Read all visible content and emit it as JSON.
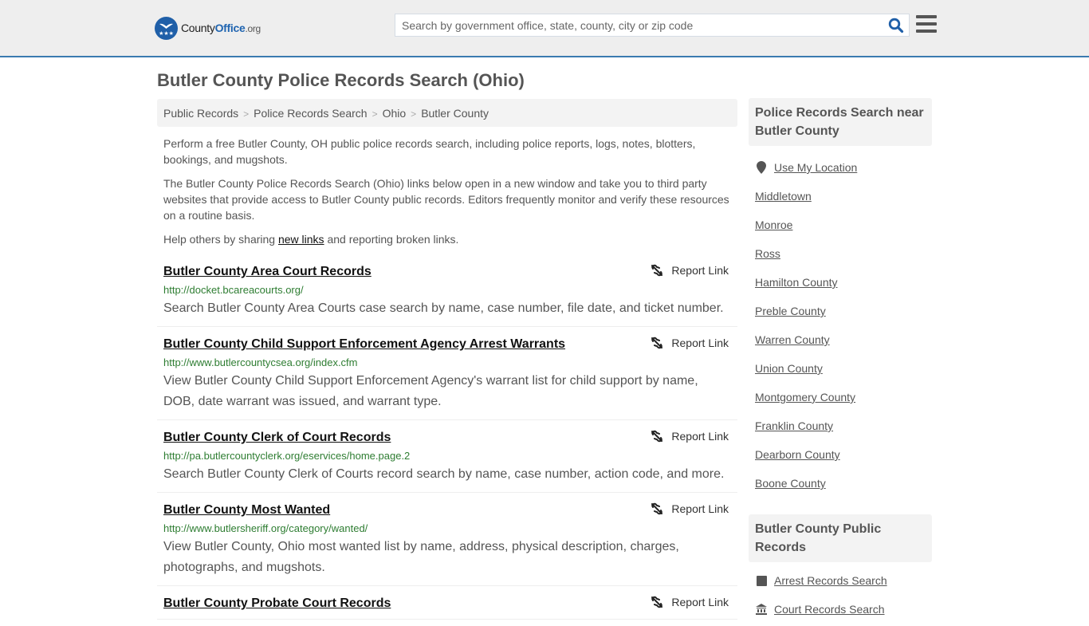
{
  "header": {
    "logo": {
      "name_part1": "County",
      "name_part2": "Office",
      "name_part3": ".org",
      "brand_color": "#1f5fa8"
    },
    "search": {
      "placeholder": "Search by government office, state, county, city or zip code",
      "value": ""
    },
    "search_icon": "search-icon",
    "menu_icon": "hamburger-menu-icon"
  },
  "page": {
    "title": "Butler County Police Records Search (Ohio)",
    "breadcrumb": [
      "Public Records",
      "Police Records Search",
      "Ohio",
      "Butler County"
    ],
    "intro": {
      "p1": "Perform a free Butler County, OH public police records search, including police reports, logs, notes, blotters, bookings, and mugshots.",
      "p2": "The Butler County Police Records Search (Ohio) links below open in a new window and take you to third party websites that provide access to Butler County public records. Editors frequently monitor and verify these resources on a routine basis.",
      "p3_before": "Help others by sharing ",
      "p3_link": "new links",
      "p3_after": " and reporting broken links."
    },
    "report_label": "Report Link",
    "results": [
      {
        "title": "Butler County Area Court Records",
        "url": "http://docket.bcareacourts.org/",
        "description": "Search Butler County Area Courts case search by name, case number, file date, and ticket number."
      },
      {
        "title": "Butler County Child Support Enforcement Agency Arrest Warrants",
        "url": "http://www.butlercountycsea.org/index.cfm",
        "description": "View Butler County Child Support Enforcement Agency's warrant list for child support by name, DOB, date warrant was issued, and warrant type."
      },
      {
        "title": "Butler County Clerk of Court Records",
        "url": "http://pa.butlercountyclerk.org/eservices/home.page.2",
        "description": "Search Butler County Clerk of Courts record search by name, case number, action code, and more."
      },
      {
        "title": "Butler County Most Wanted",
        "url": "http://www.butlersheriff.org/category/wanted/",
        "description": "View Butler County, Ohio most wanted list by name, address, physical description, charges, photographs, and mugshots."
      },
      {
        "title": "Butler County Probate Court Records",
        "url": "",
        "description": ""
      }
    ]
  },
  "sidebar": {
    "nearby": {
      "heading": "Police Records Search near Butler County",
      "use_location": "Use My Location",
      "items": [
        "Middletown",
        "Monroe",
        "Ross",
        "Hamilton County",
        "Preble County",
        "Warren County",
        "Union County",
        "Montgomery County",
        "Franklin County",
        "Dearborn County",
        "Boone County"
      ]
    },
    "public_records": {
      "heading": "Butler County Public Records",
      "items": [
        {
          "label": "Arrest Records Search",
          "icon": "arrest-square-icon"
        },
        {
          "label": "Court Records Search",
          "icon": "courthouse-icon"
        }
      ]
    }
  }
}
